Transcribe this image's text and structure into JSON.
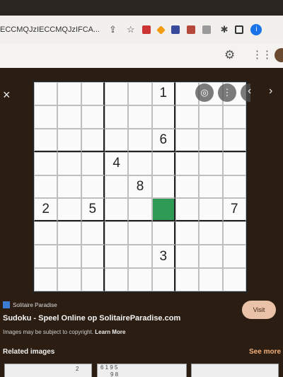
{
  "browser": {
    "url": "ECCMQJzIECCMQJzIFCA...",
    "profile_initial": "i"
  },
  "toolbar": {
    "settings_icon": "gear-icon",
    "apps_icon": "apps-grid-icon"
  },
  "viewer": {
    "close_glyph": "×",
    "prev_glyph": "‹",
    "next_glyph": "›",
    "selected_cell": [
      5,
      5
    ],
    "grid": [
      [
        "",
        "",
        "",
        "",
        "",
        "1",
        "",
        "",
        ""
      ],
      [
        "",
        "",
        "",
        "",
        "",
        "",
        "",
        "",
        ""
      ],
      [
        "",
        "",
        "",
        "",
        "",
        "6",
        "",
        "",
        ""
      ],
      [
        "",
        "",
        "",
        "4",
        "",
        "",
        "",
        "",
        ""
      ],
      [
        "",
        "",
        "",
        "",
        "8",
        "",
        "",
        "",
        ""
      ],
      [
        "2",
        "",
        "5",
        "",
        "",
        "",
        "",
        "",
        "7"
      ],
      [
        "",
        "",
        "",
        "",
        "",
        "",
        "",
        "",
        ""
      ],
      [
        "",
        "",
        "",
        "",
        "",
        "3",
        "",
        "",
        ""
      ],
      [
        "",
        "",
        "",
        "",
        "",
        "",
        "",
        "",
        ""
      ]
    ]
  },
  "result": {
    "source": "Solitaire Paradise",
    "title": "Sudoku - Speel Online op SolitaireParadise.com",
    "copyright_note": "Images may be subject to copyright.",
    "learn_more": "Learn More",
    "visit_label": "Visit"
  },
  "related": {
    "heading": "Related images",
    "see_more": "See more",
    "thumb1_text": "2",
    "thumb2_text": "6   1 9 5",
    "thumb2_text_row2": "9 8"
  },
  "colors": {
    "selected_cell": "#2e9a54",
    "viewer_bg": "#2b1d12",
    "visit_bg": "#e9c2a8",
    "see_more": "#f2b07a"
  }
}
